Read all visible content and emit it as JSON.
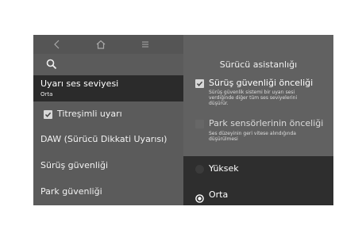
{
  "nav": {
    "back_icon": "chevron-left-icon",
    "home_icon": "home-icon",
    "menu_icon": "menu-icon"
  },
  "sidebar": {
    "search_icon": "search-icon",
    "selected_item": {
      "title": "Uyarı ses seviyesi",
      "value": "Orta"
    },
    "items": [
      {
        "label": "Titreşimli uyarı",
        "checked": true
      },
      {
        "label": "DAW (Sürücü Dikkati Uyarısı)"
      },
      {
        "label": "Sürüş güvenliği"
      },
      {
        "label": "Park güvenliği"
      }
    ]
  },
  "main": {
    "title": "Sürücü asistanlığı",
    "options": [
      {
        "label": "Sürüş güvenliği önceliği",
        "checked": true,
        "description": [
          "Sürüş güvenlik sistemi bir uyarı sesi",
          "verdiğinde diğer tüm ses seviyelerini",
          "düşürür."
        ]
      },
      {
        "label": "Park sensörlerinin önceliği",
        "checked": false,
        "description": [
          "Ses düzeyinin geri vitese alındığında",
          "düşürülmesi"
        ]
      }
    ],
    "volume_levels": [
      {
        "label": "Yüksek",
        "selected": false
      },
      {
        "label": "Orta",
        "selected": true
      }
    ]
  },
  "colors": {
    "selected_bg": "#2b2b2b",
    "panel_bg": "#5b5b5b",
    "right_bg": "#616161"
  }
}
